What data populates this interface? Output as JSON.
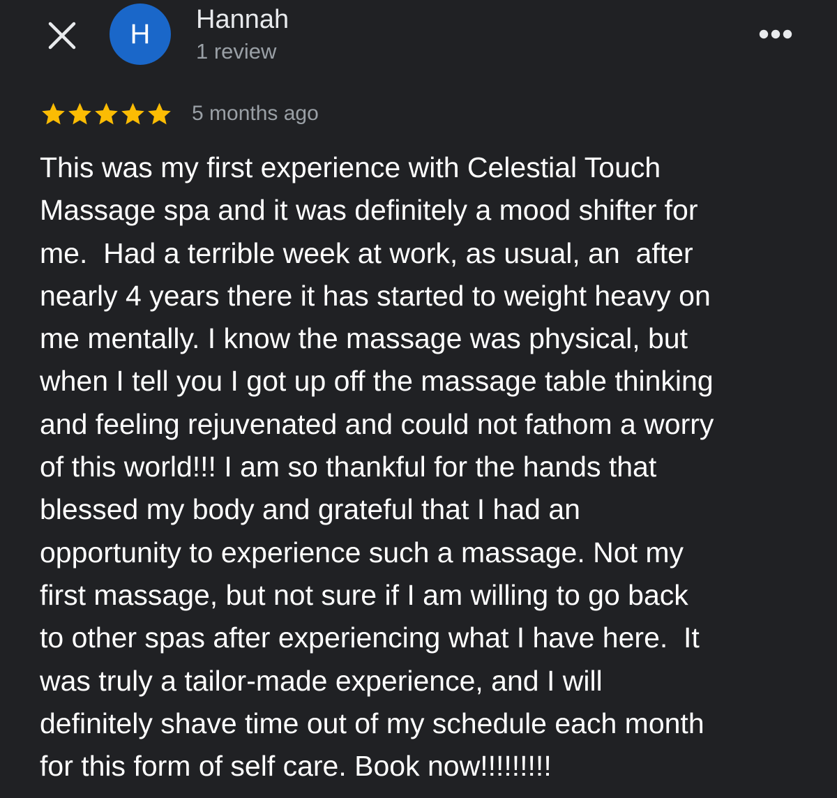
{
  "header": {
    "close_icon": "close-icon",
    "avatar_initial": "H",
    "avatar_color": "#1a67c9",
    "reviewer_name": "Hannah",
    "review_count": "1 review",
    "more_icon": "more-horizontal-icon"
  },
  "rating": {
    "stars": 5,
    "max_stars": 5,
    "star_color": "#fbbc04",
    "date": "5 months ago"
  },
  "review": {
    "lines": [
      "This was my first experience with Celestial Touch",
      "Massage spa and it was definitely a mood shifter for",
      "me.  Had a terrible week at work, as usual, an  after",
      "nearly 4 years there it has started to weight heavy on",
      "me mentally. I know the massage was physical, but",
      "when I tell you I got up off the massage table thinking",
      "and feeling rejuvenated and could not fathom a worry",
      "of this world!!! I am so thankful for the hands that",
      "blessed my body and grateful that I had an",
      "opportunity to experience such a massage. Not my",
      "first massage, but not sure if I am willing to go back",
      "to other spas after experiencing what I have here.  It",
      "was truly a tailor-made experience, and I will",
      "definitely shave time out of my schedule each month",
      "for this form of self care. Book now!!!!!!!!!"
    ]
  },
  "colors": {
    "background": "#202124",
    "primary_text": "#ffffff",
    "secondary_text": "#9aa0a6"
  }
}
